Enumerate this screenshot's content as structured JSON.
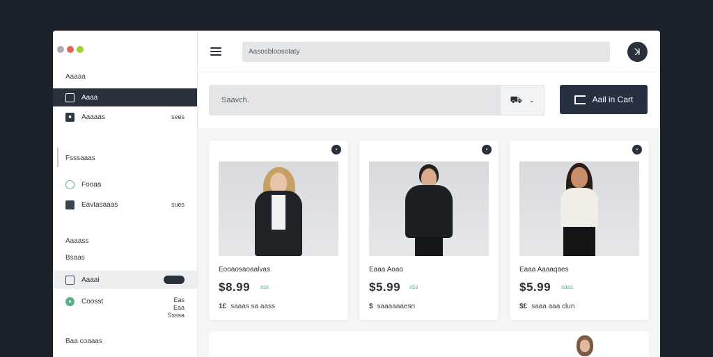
{
  "sidebar": {
    "section_1": "Aaaaa",
    "items_1": [
      {
        "label": "Aaaa",
        "meta": ""
      },
      {
        "label": "Aaaaas",
        "meta": "sees"
      }
    ],
    "section_2": "Fsssaaas",
    "items_2": [
      {
        "label": "Fooaa",
        "meta": ""
      },
      {
        "label": "Eavtasaaas",
        "meta": "sues"
      }
    ],
    "section_3": "Aaaass",
    "section_3_sub": "Bsaas",
    "items_3": [
      {
        "label": "Aaaai",
        "meta": ""
      },
      {
        "label": "Coosst",
        "meta": "",
        "stack": [
          "Eas",
          "Eaa",
          "Ssssa"
        ]
      }
    ],
    "section_4": "Baa coaaas"
  },
  "topbar": {
    "url": "Aasosbloosotaty",
    "avatar_glyph": "ꓘ"
  },
  "search": {
    "placeholder": "Saavch.",
    "cart_glyph": "⛟",
    "chevron": "⌄",
    "add_button": "Aail in Cart"
  },
  "products": [
    {
      "badge": "•",
      "name": "Eooaosaoaalvas",
      "price": "$8.99",
      "price_tag": "sss",
      "rating_num": "1£",
      "rating_text": "saaas sa aass"
    },
    {
      "badge": "•",
      "name": "Eaaa Aoao",
      "price": "$5.99",
      "price_tag": "s5s",
      "rating_num": "$",
      "rating_text": "saaaaaaesn"
    },
    {
      "badge": "•",
      "name": "Eaaa Aaaaqaes",
      "price": "$5.99",
      "price_tag": "saas",
      "rating_num": "$£",
      "rating_text": "saaa aaa clun"
    }
  ],
  "colors": {
    "background": "#1b212b",
    "sidebar_active": "#29313d",
    "accent_green": "#5fae86",
    "button_dark": "#263040"
  }
}
